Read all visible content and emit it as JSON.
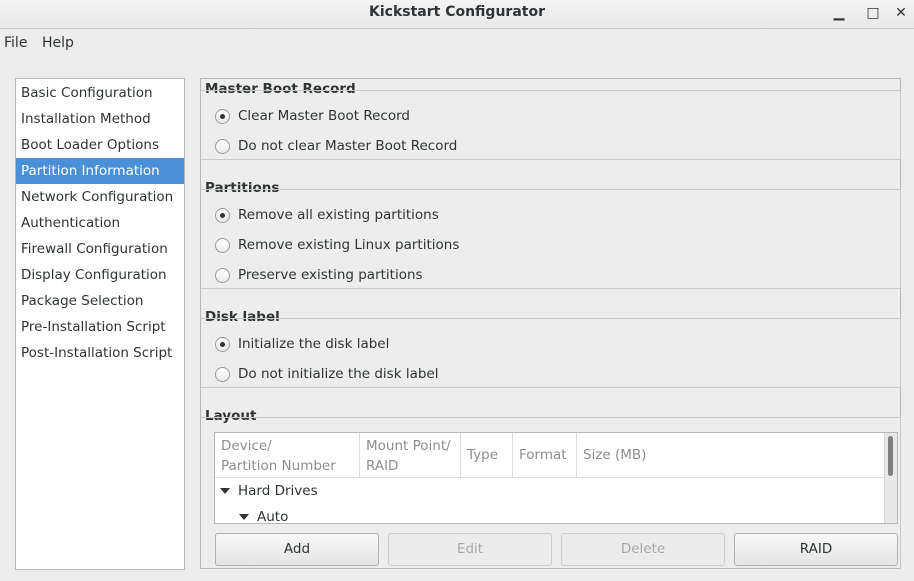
{
  "window": {
    "title": "Kickstart Configurator",
    "minimize": "▁",
    "maximize": "□",
    "close": "✕"
  },
  "menubar": {
    "items": [
      "File",
      "Help"
    ]
  },
  "sidebar": {
    "selected_index": 3,
    "items": [
      "Basic Configuration",
      "Installation Method",
      "Boot Loader Options",
      "Partition Information",
      "Network Configuration",
      "Authentication",
      "Firewall Configuration",
      "Display Configuration",
      "Package Selection",
      "Pre-Installation Script",
      "Post-Installation Script"
    ]
  },
  "mbr": {
    "title": "Master Boot Record",
    "options": [
      {
        "label": "Clear Master Boot Record",
        "selected": true
      },
      {
        "label": "Do not clear Master Boot Record",
        "selected": false
      }
    ]
  },
  "partitions": {
    "title": "Partitions",
    "options": [
      {
        "label": "Remove all existing partitions",
        "selected": true
      },
      {
        "label": "Remove existing Linux partitions",
        "selected": false
      },
      {
        "label": "Preserve existing partitions",
        "selected": false
      }
    ]
  },
  "disk_label": {
    "title": "Disk label",
    "options": [
      {
        "label": "Initialize the disk label",
        "selected": true
      },
      {
        "label": "Do not initialize the disk label",
        "selected": false
      }
    ]
  },
  "layout": {
    "title": "Layout",
    "columns": [
      {
        "line1": "Device/",
        "line2": "Partition Number"
      },
      {
        "line1": "Mount Point/",
        "line2": "RAID"
      },
      {
        "line1": "Type",
        "line2": ""
      },
      {
        "line1": "Format",
        "line2": ""
      },
      {
        "line1": "Size (MB)",
        "line2": ""
      }
    ],
    "tree": [
      {
        "label": "Hard Drives"
      },
      {
        "label": "Auto"
      }
    ]
  },
  "buttons": {
    "add": "Add",
    "edit": "Edit",
    "delete": "Delete",
    "raid": "RAID"
  },
  "colors": {
    "selection": "#4a90d9",
    "window_bg": "#ededed"
  }
}
